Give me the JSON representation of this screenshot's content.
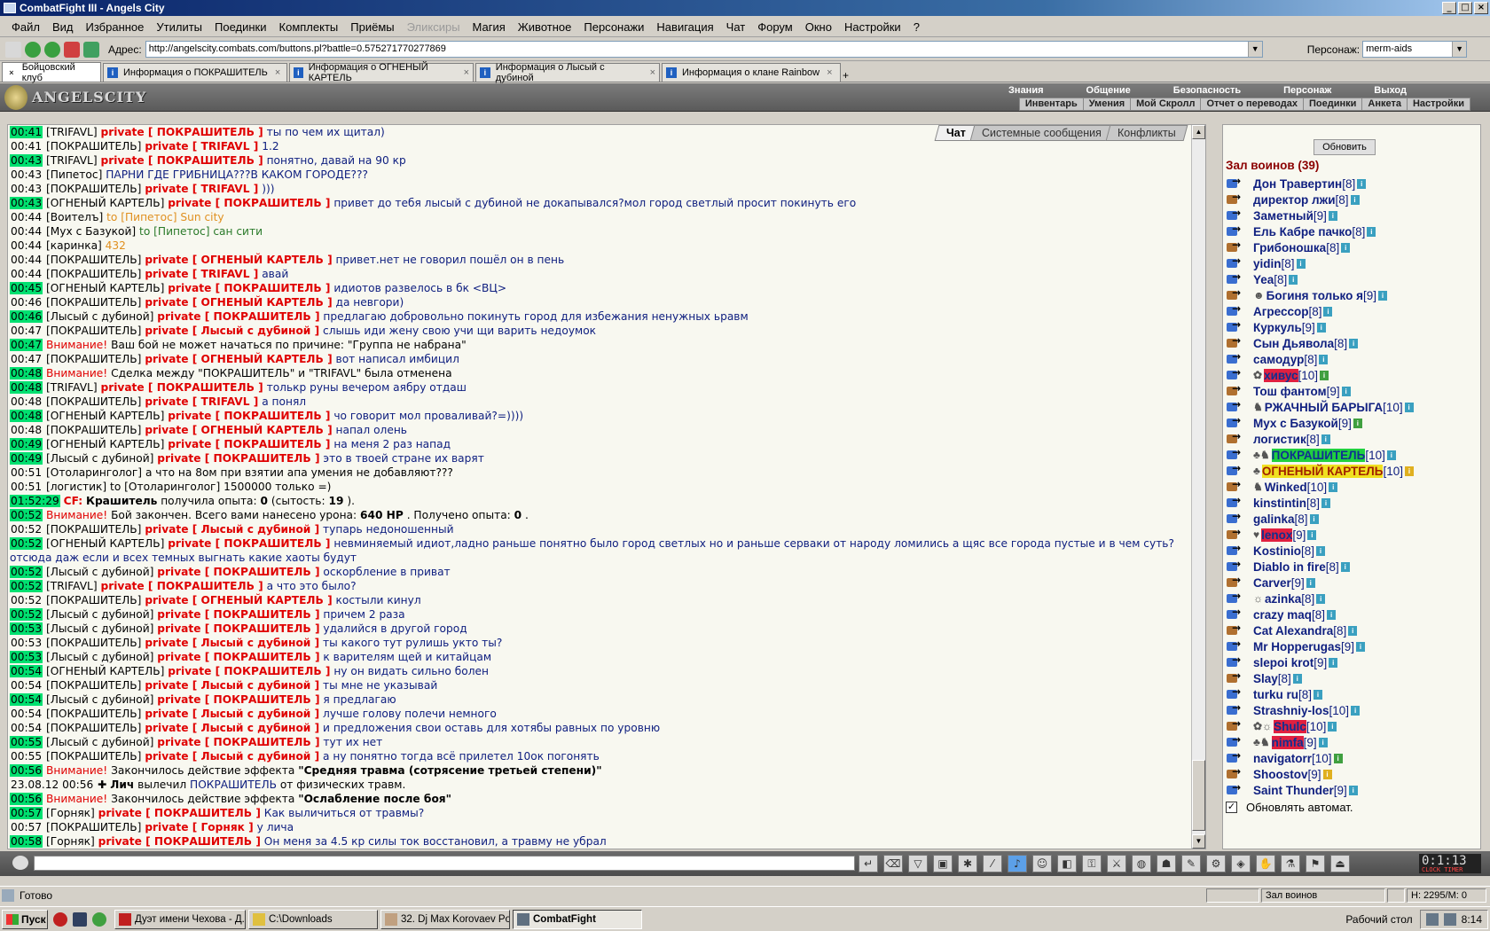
{
  "window": {
    "title": "CombatFight III - Angels City",
    "min": "_",
    "max": "□",
    "close": "×"
  },
  "menu": [
    "Файл",
    "Вид",
    "Избранное",
    "Утилиты",
    "Поединки",
    "Комплекты",
    "Приёмы",
    "Эликсиры",
    "Магия",
    "Животное",
    "Персонажи",
    "Навигация",
    "Чат",
    "Форум",
    "Окно",
    "Настройки",
    "?"
  ],
  "menu_disabled": "Эликсиры",
  "address": {
    "label": "Адрес:",
    "url": "http://angelscity.combats.com/buttons.pl?battle=0.575271770277869"
  },
  "persona": {
    "label": "Персонаж:",
    "value": "merm-aids"
  },
  "tabs": [
    {
      "label": "Бойцовский клуб"
    },
    {
      "label": "Информация о ПОКРАШИТЕЛЬ"
    },
    {
      "label": "Информация о ОГНЕНЫЙ КАРТЕЛЬ"
    },
    {
      "label": "Информация о Лысый с дубиной"
    },
    {
      "label": "Информация о клане Rainbow"
    }
  ],
  "game_header": {
    "logo": "ANGELSCITY",
    "top": [
      "Знания",
      "Общение",
      "Безопасность",
      "Персонаж",
      "Выход"
    ],
    "bottom": [
      "Инвентарь",
      "Умения",
      "Мой Скролл",
      "Отчет о переводах",
      "Поединки",
      "Анкета",
      "Настройки"
    ]
  },
  "chat_tabs": [
    "Чат",
    "Системные сообщения",
    "Конфликты"
  ],
  "chat": [
    {
      "t": "00:41",
      "hl": true,
      "s": "[TRIFAVL]",
      "p": "private [ ПОКРАШИТЕЛЬ ]",
      "m": "ты по чем их щитал)"
    },
    {
      "t": "00:41",
      "hl": false,
      "s": "[ПОКРАШИТЕЛЬ]",
      "p": "private [ TRIFAVL ]",
      "m": "1.2"
    },
    {
      "t": "00:43",
      "hl": true,
      "s": "[TRIFAVL]",
      "p": "private [ ПОКРАШИТЕЛЬ ]",
      "m": "понятно, давай на 90 кр"
    },
    {
      "t": "00:43",
      "hl": false,
      "s": "[Пипетос]",
      "p": "",
      "m": "ПАРНИ ГДЕ ГРИБНИЦА???В КАКОМ ГОРОДЕ???"
    },
    {
      "t": "00:43",
      "hl": false,
      "s": "[ПОКРАШИТЕЛЬ]",
      "p": "private [ TRIFAVL ]",
      "m": ")))"
    },
    {
      "t": "00:43",
      "hl": true,
      "s": "[ОГНЕНЫЙ КАРТЕЛЬ]",
      "p": "private [ ПОКРАШИТЕЛЬ ]",
      "m": "привет до тебя лысый с дубиной не докапывался?мол город светлый просит покинуть его"
    },
    {
      "t": "00:44",
      "hl": false,
      "s": "[Воителъ]",
      "or": "to [Пипетос] Sun city"
    },
    {
      "t": "00:44",
      "hl": false,
      "s": "[Мух с Базукой]",
      "gr": "to [Пипетос] сан сити"
    },
    {
      "t": "00:44",
      "hl": false,
      "s": "[каринка]",
      "or": "432"
    },
    {
      "t": "00:44",
      "hl": false,
      "s": "[ПОКРАШИТЕЛЬ]",
      "p": "private [ ОГНЕНЫЙ КАРТЕЛЬ ]",
      "m": "привет.нет не говорил пошёл он в пень"
    },
    {
      "t": "00:44",
      "hl": false,
      "s": "[ПОКРАШИТЕЛЬ]",
      "p": "private [ TRIFAVL ]",
      "m": "авай"
    },
    {
      "t": "00:45",
      "hl": true,
      "s": "[ОГНЕНЫЙ КАРТЕЛЬ]",
      "p": "private [ ПОКРАШИТЕЛЬ ]",
      "m": "идиотов развелось в бк <ВЦ>"
    },
    {
      "t": "00:46",
      "hl": false,
      "s": "[ПОКРАШИТЕЛЬ]",
      "p": "private [ ОГНЕНЫЙ КАРТЕЛЬ ]",
      "m": "да невгори)"
    },
    {
      "t": "00:46",
      "hl": true,
      "s": "[Лысый с дубиной]",
      "p": "private [ ПОКРАШИТЕЛЬ ]",
      "m": "предлагаю добровольно покинуть город для избежания ненужных ьравм"
    },
    {
      "t": "00:47",
      "hl": false,
      "s": "[ПОКРАШИТЕЛЬ]",
      "p": "private [ Лысый с дубиной ]",
      "m": "слышь иди жену свою учи щи варить недоумок"
    },
    {
      "t": "00:47",
      "hl": true,
      "w": "Внимание!",
      "sys": "Ваш бой не может начаться по причине: \"Группа не набрана\""
    },
    {
      "t": "00:47",
      "hl": false,
      "s": "[ПОКРАШИТЕЛЬ]",
      "p": "private [ ОГНЕНЫЙ КАРТЕЛЬ ]",
      "m": "вот написал имбицил"
    },
    {
      "t": "00:48",
      "hl": true,
      "w": "Внимание!",
      "sys": "Сделка между \"ПОКРАШИТЕЛЬ\" и \"TRIFAVL\" была отменена"
    },
    {
      "t": "00:48",
      "hl": true,
      "s": "[TRIFAVL]",
      "p": "private [ ПОКРАШИТЕЛЬ ]",
      "m": "толькр руны вечером аябру отдаш"
    },
    {
      "t": "00:48",
      "hl": false,
      "s": "[ПОКРАШИТЕЛЬ]",
      "p": "private [ TRIFAVL ]",
      "m": "а понял"
    },
    {
      "t": "00:48",
      "hl": true,
      "s": "[ОГНЕНЫЙ КАРТЕЛЬ]",
      "p": "private [ ПОКРАШИТЕЛЬ ]",
      "m": "чо говорит мол проваливай?=))))"
    },
    {
      "t": "00:48",
      "hl": false,
      "s": "[ПОКРАШИТЕЛЬ]",
      "p": "private [ ОГНЕНЫЙ КАРТЕЛЬ ]",
      "m": "напал олень"
    },
    {
      "t": "00:49",
      "hl": true,
      "s": "[ОГНЕНЫЙ КАРТЕЛЬ]",
      "p": "private [ ПОКРАШИТЕЛЬ ]",
      "m": "на меня 2 раз напад"
    },
    {
      "t": "00:49",
      "hl": true,
      "s": "[Лысый с дубиной]",
      "p": "private [ ПОКРАШИТЕЛЬ ]",
      "m": "это в твоей стране их варят"
    },
    {
      "t": "00:51",
      "hl": false,
      "s": "[Отоларинголог]",
      "sys": "а что на 8ом при взятии апа умения не добавляют???"
    },
    {
      "t": "00:51",
      "hl": false,
      "s": "[логистик]",
      "sys": "to [Отоларинголог] 1500000 только =)"
    },
    {
      "t": "01:52:29",
      "hl": true,
      "cf": true
    },
    {
      "t": "00:52",
      "hl": true,
      "w": "Внимание!",
      "battle": true
    },
    {
      "t": "00:52",
      "hl": false,
      "s": "[ПОКРАШИТЕЛЬ]",
      "p": "private [ Лысый с дубиной ]",
      "m": "тупарь недоношенный"
    },
    {
      "t": "00:52",
      "hl": true,
      "s": "[ОГНЕНЫЙ КАРТЕЛЬ]",
      "p": "private [ ПОКРАШИТЕЛЬ ]",
      "m": "невминяемый идиот,ладно раньше понятно было город светлых но и раньше серваки от народу ломились а щяс все города пустые и в чем суть?отсюда даж если и всех темных выгнать какие хаоты будут",
      "wrap": true
    },
    {
      "t": "00:52",
      "hl": true,
      "s": "[Лысый с дубиной]",
      "p": "private [ ПОКРАШИТЕЛЬ ]",
      "m": "оскорбление в приват"
    },
    {
      "t": "00:52",
      "hl": true,
      "s": "[TRIFAVL]",
      "p": "private [ ПОКРАШИТЕЛЬ ]",
      "m": "а что это было?"
    },
    {
      "t": "00:52",
      "hl": false,
      "s": "[ПОКРАШИТЕЛЬ]",
      "p": "private [ ОГНЕНЫЙ КАРТЕЛЬ ]",
      "m": "костыли кинул"
    },
    {
      "t": "00:52",
      "hl": true,
      "s": "[Лысый с дубиной]",
      "p": "private [ ПОКРАШИТЕЛЬ ]",
      "m": "причем 2 раза"
    },
    {
      "t": "00:53",
      "hl": true,
      "s": "[Лысый с дубиной]",
      "p": "private [ ПОКРАШИТЕЛЬ ]",
      "m": "удалийся в другой город"
    },
    {
      "t": "00:53",
      "hl": false,
      "s": "[ПОКРАШИТЕЛЬ]",
      "p": "private [ Лысый с дубиной ]",
      "m": "ты какого тут рулишь укто ты?"
    },
    {
      "t": "00:53",
      "hl": true,
      "s": "[Лысый с дубиной]",
      "p": "private [ ПОКРАШИТЕЛЬ ]",
      "m": "к варителям щей и китайцам"
    },
    {
      "t": "00:54",
      "hl": true,
      "s": "[ОГНЕНЫЙ КАРТЕЛЬ]",
      "p": "private [ ПОКРАШИТЕЛЬ ]",
      "m": "ну он видать сильно болен"
    },
    {
      "t": "00:54",
      "hl": false,
      "s": "[ПОКРАШИТЕЛЬ]",
      "p": "private [ Лысый с дубиной ]",
      "m": "ты мне не указывай"
    },
    {
      "t": "00:54",
      "hl": true,
      "s": "[Лысый с дубиной]",
      "p": "private [ ПОКРАШИТЕЛЬ ]",
      "m": "я предлагаю"
    },
    {
      "t": "00:54",
      "hl": false,
      "s": "[ПОКРАШИТЕЛЬ]",
      "p": "private [ Лысый с дубиной ]",
      "m": "лучше голову полечи немного"
    },
    {
      "t": "00:54",
      "hl": false,
      "s": "[ПОКРАШИТЕЛЬ]",
      "p": "private [ Лысый с дубиной ]",
      "m": "и предложения свои оставь для хотябы равных по уровню"
    },
    {
      "t": "00:55",
      "hl": true,
      "s": "[Лысый с дубиной]",
      "p": "private [ ПОКРАШИТЕЛЬ ]",
      "m": "тут их нет"
    },
    {
      "t": "00:55",
      "hl": false,
      "s": "[ПОКРАШИТЕЛЬ]",
      "p": "private [ Лысый с дубиной ]",
      "m": "а ну понятно тогда всё прилетел 10ок погонять"
    },
    {
      "t": "00:56",
      "hl": true,
      "w": "Внимание!",
      "sys": "Закончилось действие эффекта ",
      "bold": "\"Средняя травма (сотрясение третьей степени)\""
    },
    {
      "t": "23.08.12 00:56",
      "hl": false,
      "heal": true
    },
    {
      "t": "00:56",
      "hl": true,
      "w": "Внимание!",
      "sys": "Закончилось действие эффекта ",
      "bold": "\"Ослабление после боя\""
    },
    {
      "t": "00:57",
      "hl": true,
      "s": "[Горняк]",
      "p": "private [ ПОКРАШИТЕЛЬ ]",
      "m": "Как выличиться от травмы?"
    },
    {
      "t": "00:57",
      "hl": false,
      "s": "[ПОКРАШИТЕЛЬ]",
      "p": "private [ Горняк ]",
      "m": "у лича"
    },
    {
      "t": "00:58",
      "hl": true,
      "s": "[Горняк]",
      "p": "private [ ПОКРАШИТЕЛЬ ]",
      "m": "Он меня за 4.5 кр силы ток восстановил, а травму не убрал"
    }
  ],
  "chat_special": {
    "cf_prefix": "CF:",
    "cf_name": "Крашитель",
    "cf_text1": "получила опыта:",
    "cf_v1": "0",
    "cf_text2": "(сытость:",
    "cf_v2": "19",
    "cf_text3": ").",
    "battle_text1": "Бой закончен. Всего вами нанесено урона:",
    "battle_v1": "640 HP",
    "battle_text2": ". Получено опыта:",
    "battle_v2": "0",
    "battle_text3": ".",
    "heal_who": "Лич",
    "heal_verb": "вылечил",
    "heal_target": "ПОКРАШИТЕЛЬ",
    "heal_text": "от физических травм."
  },
  "hall": {
    "refresh": "Обновить",
    "title": "Зал воинов (39)",
    "players": [
      {
        "n": "Дон Травертин",
        "l": "[8]"
      },
      {
        "n": "директор лжи",
        "l": "[8]"
      },
      {
        "n": "Заметный",
        "l": "[9]"
      },
      {
        "n": "Ель Кабре пачко",
        "l": "[8]"
      },
      {
        "n": "Грибоношка",
        "l": "[8]"
      },
      {
        "n": "yidin",
        "l": "[8]"
      },
      {
        "n": "Yea",
        "l": "[8]"
      },
      {
        "n": "Богиня только я",
        "l": "[9]",
        "em": "☻"
      },
      {
        "n": "Агрессор",
        "l": "[8]"
      },
      {
        "n": "Куркуль",
        "l": "[9]"
      },
      {
        "n": "Сын Дьявола",
        "l": "[8]"
      },
      {
        "n": "самодур",
        "l": "[8]"
      },
      {
        "n": "хивус",
        "l": "[10]",
        "c": "red",
        "em": "✿"
      },
      {
        "n": "Тош фантом",
        "l": "[9]"
      },
      {
        "n": "РЖАЧНЫЙ БАРЫГА",
        "l": "[10]",
        "em": "♞"
      },
      {
        "n": "Мух с Базукой",
        "l": "[9]"
      },
      {
        "n": "логистик",
        "l": "[8]"
      },
      {
        "n": "ПОКРАШИТЕЛЬ",
        "l": "[10]",
        "c": "grn",
        "em": "♣♞"
      },
      {
        "n": "ОГНЕНЫЙ КАРТЕЛЬ",
        "l": "[10]",
        "c": "yel",
        "em": "♣"
      },
      {
        "n": "Winked",
        "l": "[10]",
        "em": "♞"
      },
      {
        "n": "kinstintin",
        "l": "[8]"
      },
      {
        "n": "galinka",
        "l": "[8]"
      },
      {
        "n": "lenox",
        "l": "[9]",
        "c": "red",
        "em": "♥"
      },
      {
        "n": "Kostinio",
        "l": "[8]"
      },
      {
        "n": "Diablo in fire",
        "l": "[8]"
      },
      {
        "n": "Carver",
        "l": "[9]"
      },
      {
        "n": "azinka",
        "l": "[8]",
        "em": "☼"
      },
      {
        "n": "crazy maq",
        "l": "[8]"
      },
      {
        "n": "Cat Alexandra",
        "l": "[8]"
      },
      {
        "n": "Mr Hopperugas",
        "l": "[9]"
      },
      {
        "n": "slepoi krot",
        "l": "[9]"
      },
      {
        "n": "Slay",
        "l": "[8]"
      },
      {
        "n": "turku ru",
        "l": "[8]"
      },
      {
        "n": "Strashniy-los",
        "l": "[10]"
      },
      {
        "n": "Shulc",
        "l": "[10]",
        "c": "red",
        "em": "✿☼"
      },
      {
        "n": "nimfa",
        "l": "[9]",
        "c": "red",
        "em": "♣♞"
      },
      {
        "n": "navigatorr",
        "l": "[10]"
      },
      {
        "n": "Shoostov",
        "l": "[9]"
      },
      {
        "n": "Saint Thunder",
        "l": "[9]"
      }
    ],
    "autorefresh": "Обновлять автомат.",
    "autorefresh_checked": "✓"
  },
  "clock": {
    "time": "0:1:13",
    "label": "CLOCK  TIMER"
  },
  "status": {
    "text": "Готово",
    "location": "Зал воинов",
    "hp": "H: 2295/M: 0"
  },
  "taskbar": {
    "start": "Пуск",
    "tasks": [
      "Дуэт имени Чехова - Д...",
      "C:\\Downloads",
      "32. Dj Max Korovaev Po...",
      "CombatFight"
    ],
    "desktop": "Рабочий стол",
    "time": "8:14"
  },
  "icons": {
    "back": "back-arrow-icon",
    "forward": "forward-arrow-icon",
    "stop": "stop-icon",
    "refresh": "refresh-icon"
  }
}
